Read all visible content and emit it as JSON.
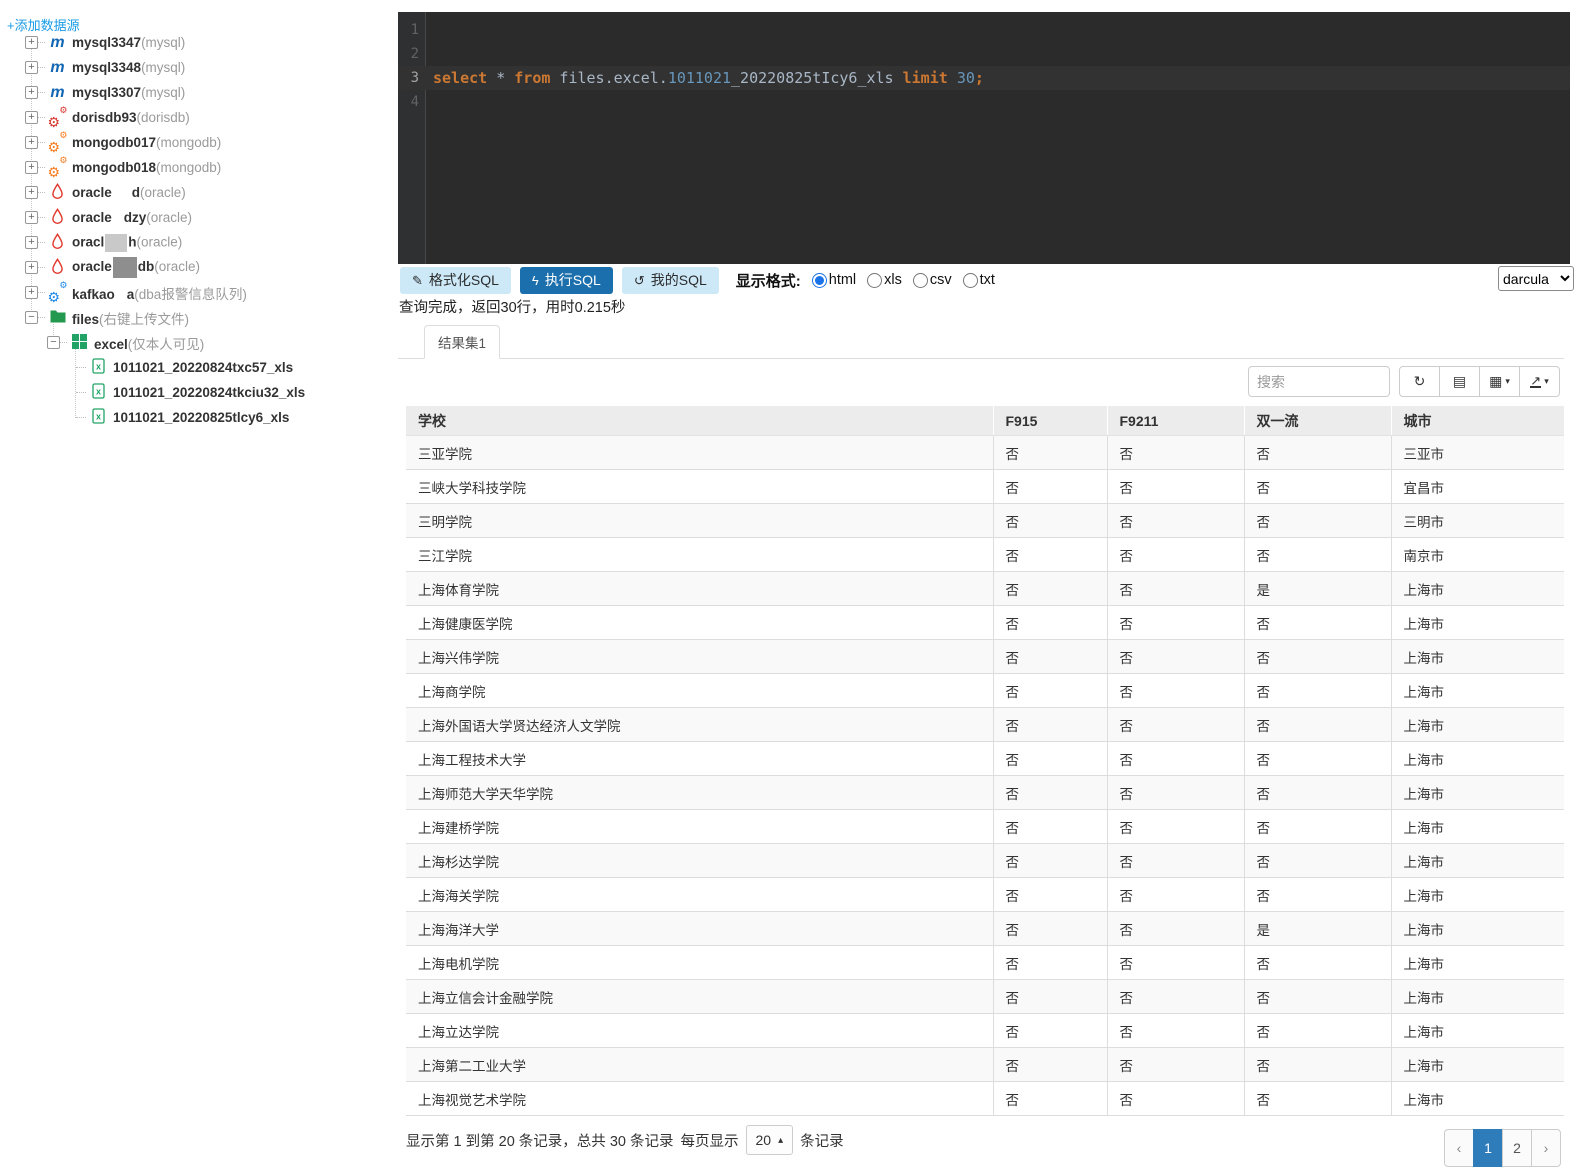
{
  "colors": {
    "accent_blue": "#1c6fad",
    "link_blue": "#1a9be6",
    "pagination_active": "#2e7cba",
    "editor_bg": "#2b2b2b",
    "kw": "#cc7832",
    "num": "#6897bb",
    "plain": "#a9b7c6",
    "mysql_icon": "#1468b3",
    "dorisdb_icon": "#d6372e",
    "mongodb_icon": "#f57c1f",
    "kafka_icon": "#1e88e5",
    "folder_green": "#23984f",
    "excel_green": "#21a366"
  },
  "sidebar": {
    "add_source_label": "+添加数据源",
    "tree": [
      {
        "level": 0,
        "toggle": "plus",
        "icon": "mysql",
        "iconName": "mysql-icon",
        "name": "mysql3347",
        "suffix": "(mysql)"
      },
      {
        "level": 0,
        "toggle": "plus",
        "icon": "mysql",
        "iconName": "mysql-icon",
        "name": "mysql3348",
        "suffix": "(mysql)"
      },
      {
        "level": 0,
        "toggle": "plus",
        "icon": "mysql",
        "iconName": "mysql-icon",
        "name": "mysql3307",
        "suffix": "(mysql)"
      },
      {
        "level": 0,
        "toggle": "plus",
        "icon": "cogs",
        "iconName": "dorisdb-icon",
        "iconColor": "#d6372e",
        "name": "dorisdb93",
        "suffix": "(dorisdb)"
      },
      {
        "level": 0,
        "toggle": "plus",
        "icon": "cogs",
        "iconName": "mongodb-icon",
        "iconColor": "#f57c1f",
        "name": "mongodb017",
        "suffix": "(mongodb)"
      },
      {
        "level": 0,
        "toggle": "plus",
        "icon": "cogs",
        "iconName": "mongodb-icon",
        "iconColor": "#f57c1f",
        "name": "mongodb018",
        "suffix": "(mongodb)"
      },
      {
        "level": 0,
        "toggle": "plus",
        "icon": "oracle",
        "iconName": "oracle-icon",
        "name": "oracle",
        "redaction": "gap-w",
        "tail": "d",
        "suffix": "(oracle)"
      },
      {
        "level": 0,
        "toggle": "plus",
        "icon": "oracle",
        "iconName": "oracle-icon",
        "name": "oracle",
        "redaction": "gap-ws",
        "tail": "dzy",
        "suffix": "(oracle)"
      },
      {
        "level": 0,
        "toggle": "plus",
        "icon": "oracle",
        "iconName": "oracle-icon",
        "name": "oracl",
        "redaction": "gap-light",
        "tail": "h",
        "suffix": "(oracle)"
      },
      {
        "level": 0,
        "toggle": "plus",
        "icon": "oracle",
        "iconName": "oracle-icon",
        "name": "oracle",
        "redaction": "gap-dark",
        "tail": "db",
        "suffix": "(oracle)"
      },
      {
        "level": 0,
        "toggle": "plus",
        "icon": "cogs",
        "iconName": "kafka-icon",
        "iconColor": "#1e88e5",
        "name": "kafkao",
        "redaction": "gap-ws",
        "tail": "a",
        "suffix": "(dba报警信息队列)"
      },
      {
        "level": 0,
        "toggle": "minus",
        "icon": "folder",
        "iconName": "folder-icon",
        "name": "files",
        "suffix": "(右键上传文件)"
      },
      {
        "level": 1,
        "toggle": "minus",
        "icon": "excel",
        "iconName": "excel-icon",
        "name": "excel",
        "suffix": "(仅本人可见)"
      },
      {
        "level": 2,
        "toggle": null,
        "icon": "xls",
        "iconName": "xls-file-icon",
        "name": "1011021_20220824txc57_xls",
        "suffix": ""
      },
      {
        "level": 2,
        "toggle": null,
        "icon": "xls",
        "iconName": "xls-file-icon",
        "name": "1011021_20220824tkciu32_xls",
        "suffix": ""
      },
      {
        "level": 2,
        "toggle": null,
        "icon": "xls",
        "iconName": "xls-file-icon",
        "name": "1011021_20220825tlcy6_xls",
        "suffix": ""
      }
    ]
  },
  "editor": {
    "lines": [
      {
        "no": "1",
        "current": false,
        "tokens": []
      },
      {
        "no": "2",
        "current": false,
        "tokens": []
      },
      {
        "no": "3",
        "current": true,
        "tokens": [
          {
            "t": "select",
            "c": "kw"
          },
          {
            "t": " ",
            "c": "pl"
          },
          {
            "t": "*",
            "c": "pl"
          },
          {
            "t": " ",
            "c": "pl"
          },
          {
            "t": "from",
            "c": "kw"
          },
          {
            "t": " files.excel.",
            "c": "pl"
          },
          {
            "t": "1011021",
            "c": "num"
          },
          {
            "t": "_20220825tIcy6_xls ",
            "c": "pl"
          },
          {
            "t": "limit",
            "c": "kw"
          },
          {
            "t": " ",
            "c": "pl"
          },
          {
            "t": "30",
            "c": "num"
          },
          {
            "t": ";",
            "c": "kw"
          }
        ]
      },
      {
        "no": "4",
        "current": false,
        "tokens": []
      }
    ]
  },
  "toolbar": {
    "format_label": "格式化SQL",
    "execute_label": "执行SQL",
    "my_sql_label": "我的SQL",
    "display_format_label": "显示格式:",
    "formats": [
      "html",
      "xls",
      "csv",
      "txt"
    ],
    "selected_format": "html",
    "theme": "darcula"
  },
  "status_text": "查询完成，返回30行，用时0.215秒",
  "result": {
    "tab_label": "结果集1",
    "search_placeholder": "搜索"
  },
  "table": {
    "headers": [
      "学校",
      "F915",
      "F9211",
      "双一流",
      "城市"
    ],
    "rows": [
      [
        "三亚学院",
        "否",
        "否",
        "否",
        "三亚市"
      ],
      [
        "三峡大学科技学院",
        "否",
        "否",
        "否",
        "宜昌市"
      ],
      [
        "三明学院",
        "否",
        "否",
        "否",
        "三明市"
      ],
      [
        "三江学院",
        "否",
        "否",
        "否",
        "南京市"
      ],
      [
        "上海体育学院",
        "否",
        "否",
        "是",
        "上海市"
      ],
      [
        "上海健康医学院",
        "否",
        "否",
        "否",
        "上海市"
      ],
      [
        "上海兴伟学院",
        "否",
        "否",
        "否",
        "上海市"
      ],
      [
        "上海商学院",
        "否",
        "否",
        "否",
        "上海市"
      ],
      [
        "上海外国语大学贤达经济人文学院",
        "否",
        "否",
        "否",
        "上海市"
      ],
      [
        "上海工程技术大学",
        "否",
        "否",
        "否",
        "上海市"
      ],
      [
        "上海师范大学天华学院",
        "否",
        "否",
        "否",
        "上海市"
      ],
      [
        "上海建桥学院",
        "否",
        "否",
        "否",
        "上海市"
      ],
      [
        "上海杉达学院",
        "否",
        "否",
        "否",
        "上海市"
      ],
      [
        "上海海关学院",
        "否",
        "否",
        "否",
        "上海市"
      ],
      [
        "上海海洋大学",
        "否",
        "否",
        "是",
        "上海市"
      ],
      [
        "上海电机学院",
        "否",
        "否",
        "否",
        "上海市"
      ],
      [
        "上海立信会计金融学院",
        "否",
        "否",
        "否",
        "上海市"
      ],
      [
        "上海立达学院",
        "否",
        "否",
        "否",
        "上海市"
      ],
      [
        "上海第二工业大学",
        "否",
        "否",
        "否",
        "上海市"
      ],
      [
        "上海视觉艺术学院",
        "否",
        "否",
        "否",
        "上海市"
      ]
    ]
  },
  "footer": {
    "summary": "显示第 1 到第 20 条记录，总共 30 条记录",
    "page_size_prefix": "每页显示",
    "page_size": "20",
    "page_size_suffix": "条记录",
    "pages": [
      {
        "label": "‹",
        "name": "prev-page-button",
        "active": false
      },
      {
        "label": "1",
        "name": "page-1-button",
        "active": true
      },
      {
        "label": "2",
        "name": "page-2-button",
        "active": false
      },
      {
        "label": "›",
        "name": "next-page-button",
        "active": false
      }
    ]
  }
}
